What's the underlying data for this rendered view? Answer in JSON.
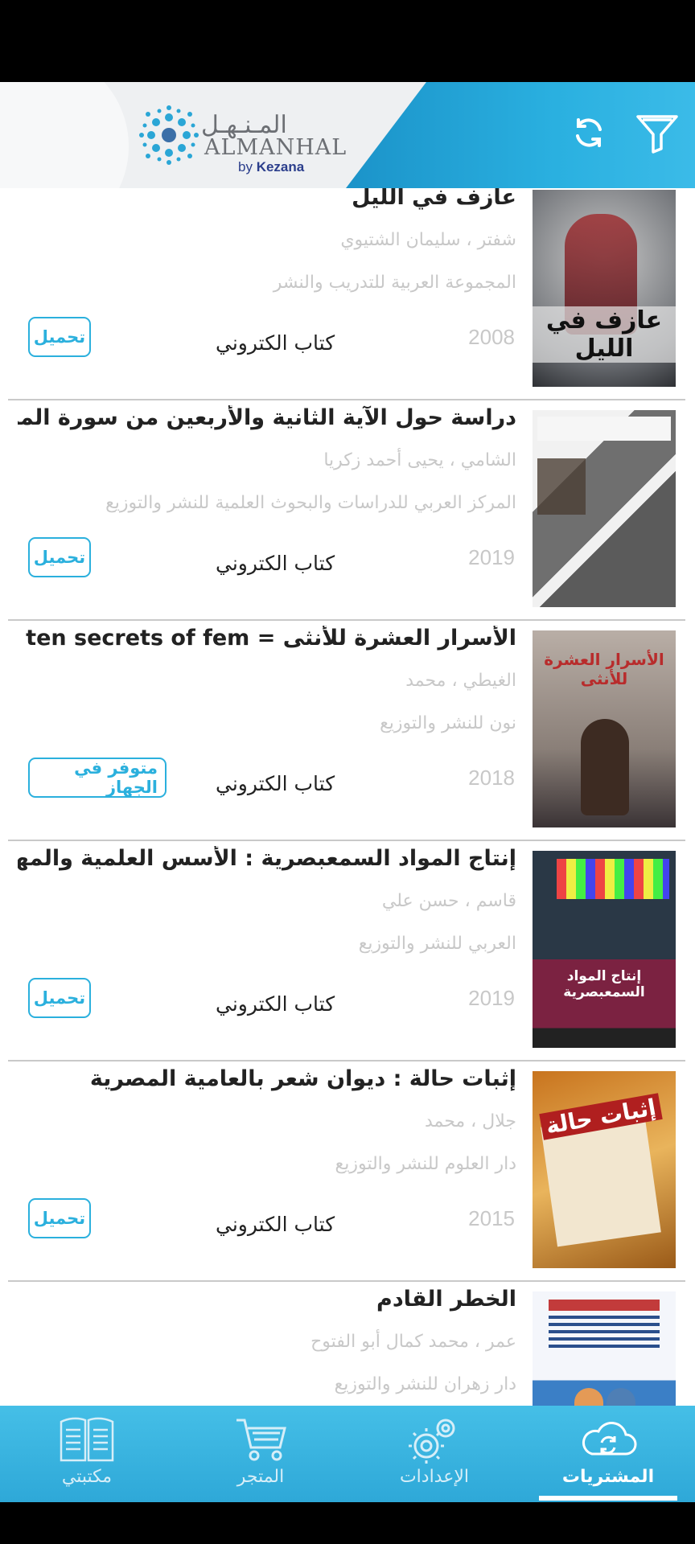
{
  "header": {
    "logo_ar": "المـنـهـل",
    "logo_en": "ALMANHAL",
    "logo_by": "by",
    "logo_brand": "Kezana",
    "refresh_icon": "refresh-icon",
    "filter_icon": "filter-icon"
  },
  "books": [
    {
      "title": "عازف في الليل",
      "author": "شفتر ، سليمان الشتيوي",
      "publisher": "المجموعة العربية للتدريب والنشر",
      "year": "2008",
      "type": "كتاب الكتروني",
      "action": "تحميل",
      "cover_title": "عازف في الليل",
      "cover_color": "#5a5f66"
    },
    {
      "title": "دراسة حول الآية الثانية والأربعين من سورة المائد...",
      "author": "الشامي ، يحيى أحمد زكريا",
      "publisher": "المركز العربي للدراسات والبحوث العلمية للنشر والتوزيع",
      "year": "2019",
      "type": "كتاب الكتروني",
      "action": "تحميل",
      "cover_title": "",
      "cover_color": "#6f6f6f"
    },
    {
      "title": "الأسرار العشرة للأنثى = The ten secrets of fem...",
      "author": "الغيطي ، محمد",
      "publisher": "نون للنشر والتوزيع",
      "year": "2018",
      "type": "كتاب الكتروني",
      "action": "متوفر في الجهاز",
      "cover_title": "الأسرار العشرة للأنثى",
      "cover_color": "#8a7f78"
    },
    {
      "title": "إنتاج المواد السمعبصرية : الأسس العلمية والمهنية",
      "author": "قاسم ، حسن علي",
      "publisher": "العربي للنشر والتوزيع",
      "year": "2019",
      "type": "كتاب الكتروني",
      "action": "تحميل",
      "cover_title": "إنتاج المواد السمعبصرية",
      "cover_color": "#7b2241"
    },
    {
      "title": "إثبات حالة : ديوان شعر بالعامية المصرية",
      "author": "جلال ، محمد",
      "publisher": "دار العلوم للنشر والتوزيع",
      "year": "2015",
      "type": "كتاب الكتروني",
      "action": "تحميل",
      "cover_title": "إثبات حالة",
      "cover_color": "#d99a3c"
    },
    {
      "title": "الخطر القادم",
      "author": "عمر ، محمد كمال أبو الفتوح",
      "publisher": "دار زهران للنشر والتوزيع",
      "year": "",
      "type": "",
      "action": "",
      "cover_title": "",
      "cover_color": "#3b7fc6"
    }
  ],
  "tabs": [
    {
      "label": "مكتبتي",
      "icon": "book-icon"
    },
    {
      "label": "المتجر",
      "icon": "cart-icon"
    },
    {
      "label": "الإعدادات",
      "icon": "gears-icon"
    },
    {
      "label": "المشتريات",
      "icon": "cloud-sync-icon"
    }
  ],
  "colors": {
    "accent": "#2bb0dd",
    "tabbar": "#38b4e0"
  }
}
